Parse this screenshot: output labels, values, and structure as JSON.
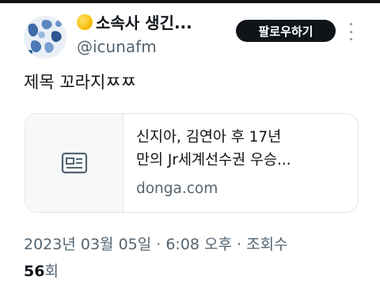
{
  "tweet": {
    "display_name": "소속사 생긴...",
    "handle": "@icunafm",
    "follow_label": "팔로우하기",
    "text": "제목 꼬라지ㅉㅉ",
    "card": {
      "title_line1": "신지아, 김연아 후 17년",
      "title_line2": "만의 Jr세계선수권 우승...",
      "domain": "donga.com"
    },
    "meta": "2023년 03월 05일 · 6:08 오후 · 조회수",
    "views_count": "56",
    "views_suffix": "회"
  },
  "colors": {
    "text_primary": "#0f1419",
    "text_secondary": "#536471",
    "follow_bg": "#0f1419",
    "card_border": "#e3e7ea"
  },
  "icons": {
    "emoji": "yellow-circle-emoji-icon",
    "more": "more-vertical-icon",
    "article": "article-icon"
  }
}
